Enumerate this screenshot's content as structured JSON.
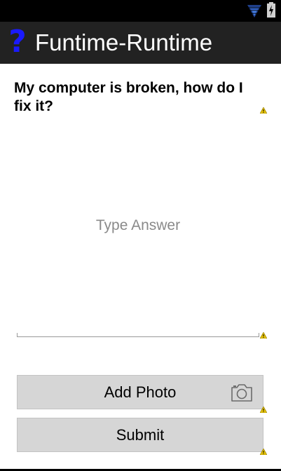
{
  "status_bar": {
    "icons": [
      "wifi-icon",
      "battery-charging-icon"
    ],
    "color": "#000000",
    "accent": "#3b6fe0"
  },
  "action_bar": {
    "icon": "question-mark-icon",
    "icon_glyph": "?",
    "title": "Funtime-Runtime",
    "background": "#222222"
  },
  "question": {
    "text": "My computer is broken, how do I fix it?"
  },
  "answer": {
    "placeholder": "Type Answer",
    "value": ""
  },
  "buttons": {
    "add_photo_label": "Add Photo",
    "add_photo_icon": "camera-icon",
    "submit_label": "Submit"
  },
  "warning_marker_color": "#e8c400"
}
